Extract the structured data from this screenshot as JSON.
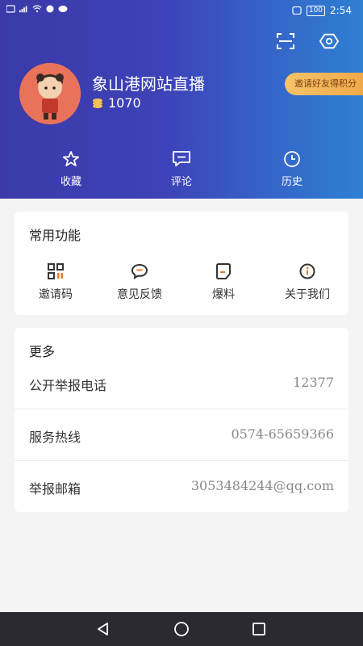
{
  "status": {
    "time": "2:54",
    "battery": "100"
  },
  "icons": {
    "scan": "scan-icon",
    "settings": "settings-hex-icon",
    "coin": "coin-icon",
    "star": "star-icon",
    "comment": "comment-icon",
    "history": "clock-icon"
  },
  "profile": {
    "nickname": "象山港网站直播",
    "points": "1070",
    "invite_badge": "邀请好友得积分"
  },
  "quick_actions": [
    {
      "label": "收藏"
    },
    {
      "label": "评论"
    },
    {
      "label": "历史"
    }
  ],
  "functions": {
    "title": "常用功能",
    "items": [
      {
        "label": "邀请码"
      },
      {
        "label": "意见反馈"
      },
      {
        "label": "爆料"
      },
      {
        "label": "关于我们"
      }
    ]
  },
  "more": {
    "title": "更多",
    "rows": [
      {
        "label": "公开举报电话",
        "value": "12377"
      },
      {
        "label": "服务热线",
        "value": "0574-65659366"
      },
      {
        "label": "举报邮箱",
        "value": "3053484244@qq.com"
      }
    ]
  },
  "colors": {
    "header_start": "#3b3aa8",
    "header_end": "#2f80d4",
    "badge": "#f5c46a",
    "func_icon_dark": "#333333",
    "func_icon_accent": "#f07a2a"
  }
}
